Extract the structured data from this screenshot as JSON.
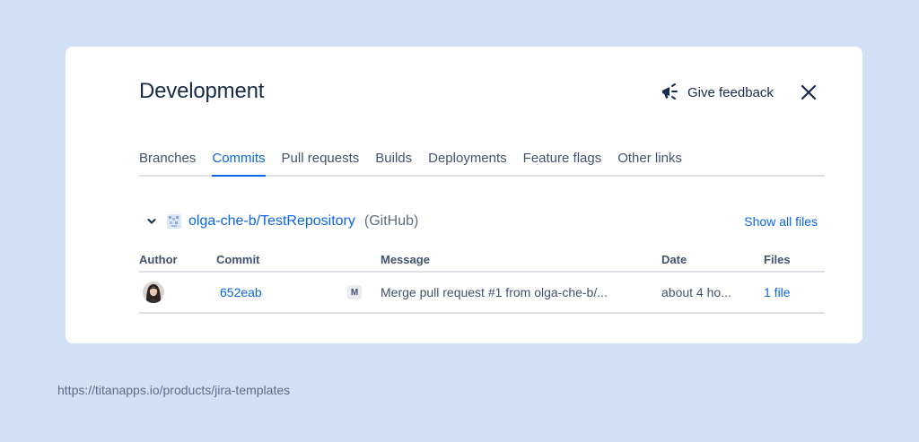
{
  "header": {
    "title": "Development",
    "feedback_label": "Give feedback",
    "close_icon": "close-icon",
    "feedback_icon": "megaphone-icon"
  },
  "tabs": [
    {
      "label": "Branches",
      "active": false
    },
    {
      "label": "Commits",
      "active": true
    },
    {
      "label": "Pull requests",
      "active": false
    },
    {
      "label": "Builds",
      "active": false
    },
    {
      "label": "Deployments",
      "active": false
    },
    {
      "label": "Feature flags",
      "active": false
    },
    {
      "label": "Other links",
      "active": false
    }
  ],
  "repository": {
    "name": "olga-che-b/TestRepository",
    "source": "(GitHub)",
    "show_all_label": "Show all files",
    "expand_icon": "chevron-down-icon",
    "repo_icon": "repository-icon"
  },
  "table": {
    "columns": [
      "Author",
      "Commit",
      "Message",
      "Date",
      "Files"
    ],
    "rows": [
      {
        "commit": "652eab",
        "badge": "M",
        "message": "Merge pull request #1 from olga-che-b/...",
        "date": "about 4 ho...",
        "files": "1 file"
      }
    ]
  },
  "footer": {
    "url": "https://titanapps.io/products/jira-templates"
  },
  "colors": {
    "background": "#d3e1f7",
    "accent": "#0c66e4",
    "text": "#172b4d"
  }
}
